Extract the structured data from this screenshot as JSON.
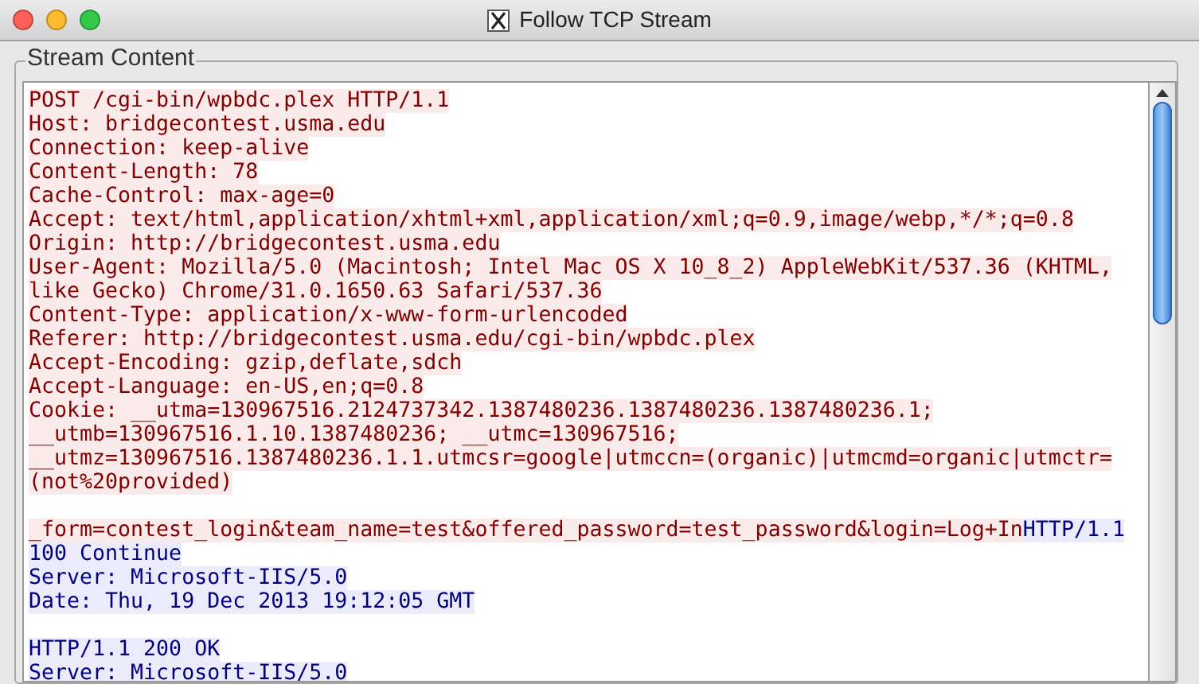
{
  "window": {
    "title": "Follow TCP Stream"
  },
  "group": {
    "title": "Stream Content"
  },
  "stream": [
    {
      "kind": "text",
      "segments": [
        {
          "text": "POST /cgi-bin/wpbdc.plex HTTP/1.1",
          "kind": "client"
        }
      ]
    },
    {
      "kind": "text",
      "segments": [
        {
          "text": "Host: bridgecontest.usma.edu",
          "kind": "client"
        }
      ]
    },
    {
      "kind": "text",
      "segments": [
        {
          "text": "Connection: keep-alive",
          "kind": "client"
        }
      ]
    },
    {
      "kind": "text",
      "segments": [
        {
          "text": "Content-Length: 78",
          "kind": "client"
        }
      ]
    },
    {
      "kind": "text",
      "segments": [
        {
          "text": "Cache-Control: max-age=0",
          "kind": "client"
        }
      ]
    },
    {
      "kind": "text",
      "segments": [
        {
          "text": "Accept: text/html,application/xhtml+xml,application/xml;q=0.9,image/webp,*/*;q=0.8",
          "kind": "client"
        }
      ]
    },
    {
      "kind": "text",
      "segments": [
        {
          "text": "Origin: http://bridgecontest.usma.edu",
          "kind": "client"
        }
      ]
    },
    {
      "kind": "text",
      "segments": [
        {
          "text": "User-Agent: Mozilla/5.0 (Macintosh; Intel Mac OS X 10_8_2) AppleWebKit/537.36 (KHTML,",
          "kind": "client"
        }
      ]
    },
    {
      "kind": "text",
      "segments": [
        {
          "text": "like Gecko) Chrome/31.0.1650.63 Safari/537.36",
          "kind": "client"
        }
      ]
    },
    {
      "kind": "text",
      "segments": [
        {
          "text": "Content-Type: application/x-www-form-urlencoded",
          "kind": "client"
        }
      ]
    },
    {
      "kind": "text",
      "segments": [
        {
          "text": "Referer: http://bridgecontest.usma.edu/cgi-bin/wpbdc.plex",
          "kind": "client"
        }
      ]
    },
    {
      "kind": "text",
      "segments": [
        {
          "text": "Accept-Encoding: gzip,deflate,sdch",
          "kind": "client"
        }
      ]
    },
    {
      "kind": "text",
      "segments": [
        {
          "text": "Accept-Language: en-US,en;q=0.8",
          "kind": "client"
        }
      ]
    },
    {
      "kind": "text",
      "segments": [
        {
          "text": "Cookie: __utma=130967516.2124737342.1387480236.1387480236.1387480236.1;",
          "kind": "client"
        }
      ]
    },
    {
      "kind": "text",
      "segments": [
        {
          "text": "__utmb=130967516.1.10.1387480236; __utmc=130967516;",
          "kind": "client"
        }
      ]
    },
    {
      "kind": "text",
      "segments": [
        {
          "text": "__utmz=130967516.1387480236.1.1.utmcsr=google|utmccn=(organic)|utmcmd=organic|utmctr=",
          "kind": "client"
        }
      ]
    },
    {
      "kind": "text",
      "segments": [
        {
          "text": "(not%20provided)",
          "kind": "client"
        }
      ]
    },
    {
      "kind": "blank"
    },
    {
      "kind": "text",
      "segments": [
        {
          "text": "_form=contest_login&team_name=test&offered_password=test_password&login=Log+In",
          "kind": "client"
        },
        {
          "text": "HTTP/1.1",
          "kind": "server"
        }
      ]
    },
    {
      "kind": "text",
      "segments": [
        {
          "text": "100 Continue",
          "kind": "server"
        }
      ]
    },
    {
      "kind": "text",
      "segments": [
        {
          "text": "Server: Microsoft-IIS/5.0",
          "kind": "server"
        }
      ]
    },
    {
      "kind": "text",
      "segments": [
        {
          "text": "Date: Thu, 19 Dec 2013 19:12:05 GMT",
          "kind": "server"
        }
      ]
    },
    {
      "kind": "blank"
    },
    {
      "kind": "text",
      "segments": [
        {
          "text": "HTTP/1.1 200 OK",
          "kind": "server"
        }
      ]
    },
    {
      "kind": "text",
      "segments": [
        {
          "text": "Server: Microsoft-IIS/5.0",
          "kind": "server"
        }
      ]
    }
  ]
}
